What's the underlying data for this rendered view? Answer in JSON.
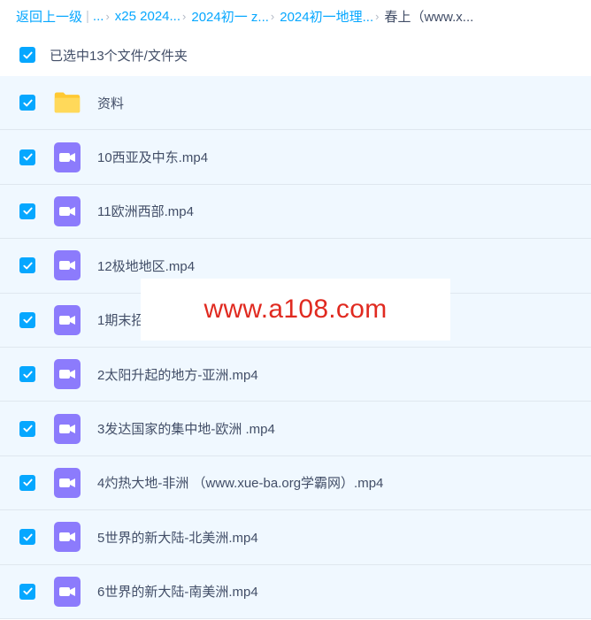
{
  "breadcrumb": {
    "back": "返回上一级",
    "ellipsis": "...",
    "items": [
      "x25 2024...",
      "2024初一 z...",
      "2024初一地理..."
    ],
    "current": "春上（www.x..."
  },
  "selection": {
    "label": "已选中13个文件/文件夹"
  },
  "files": [
    {
      "name": "资料",
      "type": "folder-icon"
    },
    {
      "name": "10西亚及中东.mp4",
      "type": "video-icon"
    },
    {
      "name": "11欧洲西部.mp4",
      "type": "video-icon"
    },
    {
      "name": "12极地地区.mp4",
      "type": "video-icon"
    },
    {
      "name": "1期末招",
      "type": "video-icon"
    },
    {
      "name": "2太阳升起的地方-亚洲.mp4",
      "type": "video-icon"
    },
    {
      "name": "3发达国家的集中地-欧洲 .mp4",
      "type": "video-icon"
    },
    {
      "name": "4灼热大地-非洲 （www.xue-ba.org学霸网）.mp4",
      "type": "video-icon"
    },
    {
      "name": "5世界的新大陆-北美洲.mp4",
      "type": "video-icon"
    },
    {
      "name": "6世界的新大陆-南美洲.mp4",
      "type": "video-icon"
    }
  ],
  "watermark": "www.a108.com",
  "colors": {
    "accent": "#06a7ff",
    "video": "#8c7bfc",
    "folder": "#ffd24f",
    "watermark": "#e02a20",
    "row_bg": "#f0f8ff"
  }
}
